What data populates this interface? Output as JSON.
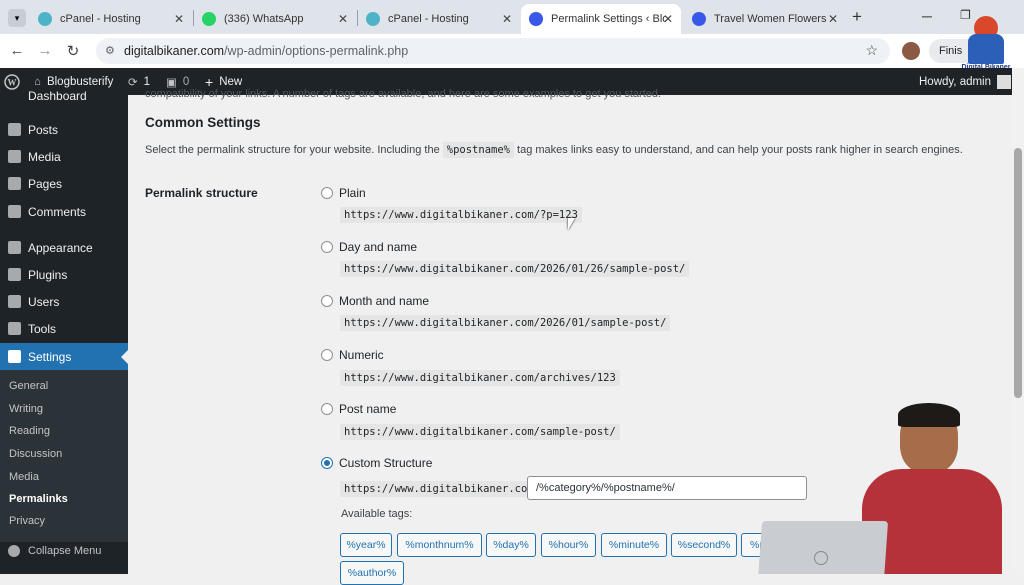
{
  "browser": {
    "tabs": [
      {
        "title": "cPanel - Hosting"
      },
      {
        "title": "(336) WhatsApp"
      },
      {
        "title": "cPanel - Hosting"
      },
      {
        "title": "Permalink Settings ‹ Blog"
      },
      {
        "title": "Travel Women Flowers W"
      }
    ],
    "new_tab": "+",
    "url_host": "digitalbikaner.com",
    "url_path": "/wp-admin/options-permalink.php",
    "profile_button": "Finis",
    "watermark": "Digital Bikaner"
  },
  "adminbar": {
    "site_name": "Blogbusterify",
    "updates_count": "1",
    "comments_count": "0",
    "new_label": "New",
    "howdy": "Howdy, admin"
  },
  "sidebar": {
    "top_item_partial": "Dashboard",
    "items": [
      "Posts",
      "Media",
      "Pages",
      "Comments",
      "Appearance",
      "Plugins",
      "Users",
      "Tools",
      "Settings"
    ],
    "submenu": [
      "General",
      "Writing",
      "Reading",
      "Discussion",
      "Media",
      "Permalinks",
      "Privacy"
    ],
    "collapse": "Collapse Menu"
  },
  "main": {
    "intro_partial": "compatibility of your links. A number of tags are available, and here are some examples to get you started.",
    "heading": "Common Settings",
    "desc_before": "Select the permalink structure for your website. Including the",
    "desc_code": "%postname%",
    "desc_after": "tag makes links easy to understand, and can help your posts rank higher in search engines.",
    "permalink_label": "Permalink structure",
    "options": [
      {
        "label": "Plain",
        "example": "https://www.digitalbikaner.com/?p=123",
        "checked": false
      },
      {
        "label": "Day and name",
        "example": "https://www.digitalbikaner.com/2026/01/26/sample-post/",
        "checked": false
      },
      {
        "label": "Month and name",
        "example": "https://www.digitalbikaner.com/2026/01/sample-post/",
        "checked": false
      },
      {
        "label": "Numeric",
        "example": "https://www.digitalbikaner.com/archives/123",
        "checked": false
      },
      {
        "label": "Post name",
        "example": "https://www.digitalbikaner.com/sample-post/",
        "checked": false
      },
      {
        "label": "Custom Structure",
        "example": "https://www.digitalbikaner.com",
        "checked": true
      }
    ],
    "custom_value": "/%category%/%postname%/",
    "available_tags_label": "Available tags:",
    "tags": [
      "%year%",
      "%monthnum%",
      "%day%",
      "%hour%",
      "%minute%",
      "%second%",
      "%p",
      "%author%"
    ]
  },
  "colors": {
    "wp_dark": "#1d2327",
    "wp_blue": "#2271b1",
    "bg": "#f0f0f1"
  }
}
